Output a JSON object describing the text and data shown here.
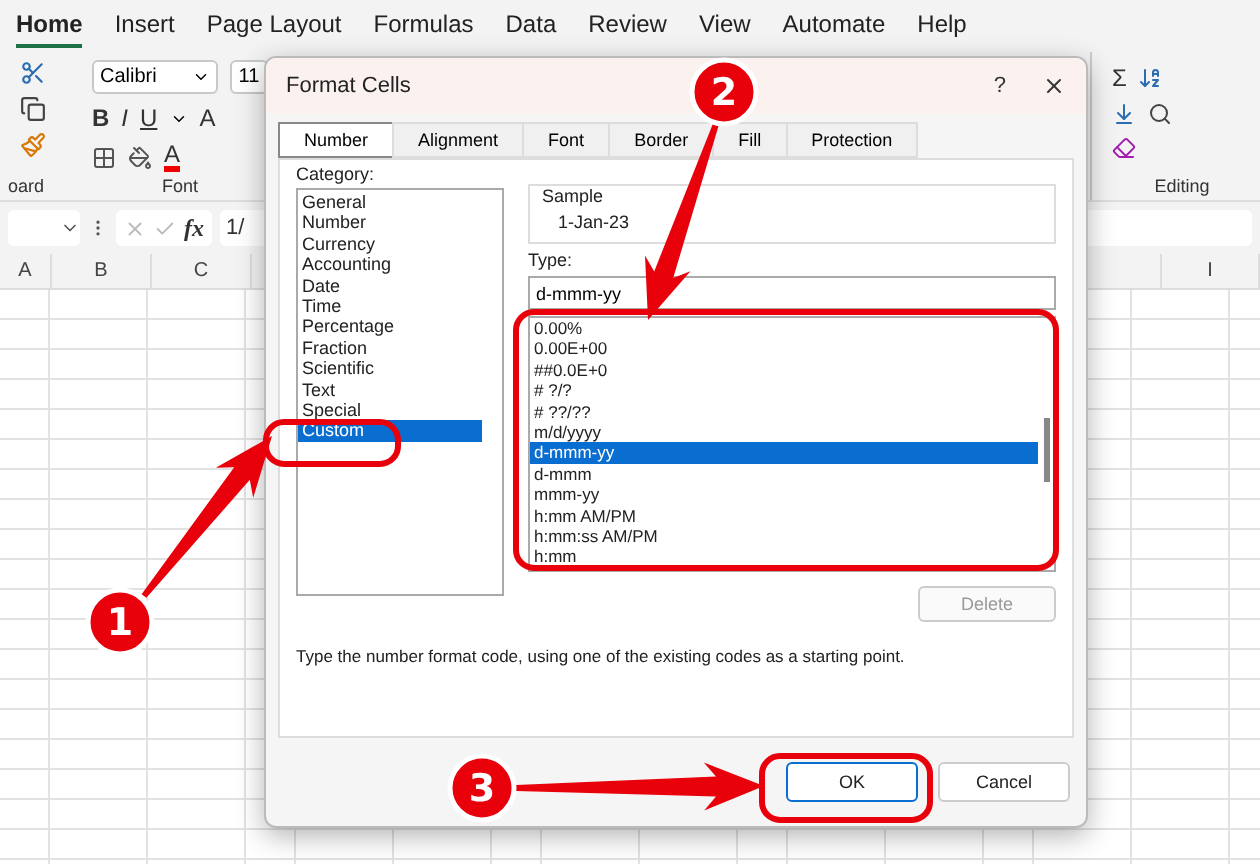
{
  "ribbon_tabs": [
    {
      "label": "Home",
      "selected": true
    },
    {
      "label": "Insert",
      "selected": false
    },
    {
      "label": "Page Layout",
      "selected": false
    },
    {
      "label": "Formulas",
      "selected": false
    },
    {
      "label": "Data",
      "selected": false
    },
    {
      "label": "Review",
      "selected": false
    },
    {
      "label": "View",
      "selected": false
    },
    {
      "label": "Automate",
      "selected": false
    },
    {
      "label": "Help",
      "selected": false
    }
  ],
  "ribbon": {
    "clipboard_label": "oard",
    "font_name": "Calibri",
    "font_size": "11",
    "bold": "B",
    "italic": "I",
    "underline": "U",
    "grow_font": "A",
    "font_color": "A",
    "font_label": "Font",
    "sum": "Σ",
    "editing_label": "Editing"
  },
  "formula_bar": {
    "fx": "fx",
    "value": "1/"
  },
  "columns": [
    "A",
    "B",
    "C"
  ],
  "right_column": "I",
  "dialog": {
    "title": "Format Cells",
    "help": "?",
    "tabs": [
      {
        "label": "Number",
        "selected": true
      },
      {
        "label": "Alignment",
        "selected": false
      },
      {
        "label": "Font",
        "selected": false
      },
      {
        "label": "Border",
        "selected": false
      },
      {
        "label": "Fill",
        "selected": false
      },
      {
        "label": "Protection",
        "selected": false
      }
    ],
    "category_label": "Category:",
    "categories": [
      {
        "label": "General",
        "selected": false
      },
      {
        "label": "Number",
        "selected": false
      },
      {
        "label": "Currency",
        "selected": false
      },
      {
        "label": "Accounting",
        "selected": false
      },
      {
        "label": "Date",
        "selected": false
      },
      {
        "label": "Time",
        "selected": false
      },
      {
        "label": "Percentage",
        "selected": false
      },
      {
        "label": "Fraction",
        "selected": false
      },
      {
        "label": "Scientific",
        "selected": false
      },
      {
        "label": "Text",
        "selected": false
      },
      {
        "label": "Special",
        "selected": false
      },
      {
        "label": "Custom",
        "selected": true
      }
    ],
    "sample_label": "Sample",
    "sample_value": "1-Jan-23",
    "type_label": "Type:",
    "type_value": "d-mmm-yy",
    "types": [
      {
        "label": "0.00%",
        "selected": false
      },
      {
        "label": "0.00E+00",
        "selected": false
      },
      {
        "label": "##0.0E+0",
        "selected": false
      },
      {
        "label": "# ?/?",
        "selected": false
      },
      {
        "label": "# ??/??",
        "selected": false
      },
      {
        "label": "m/d/yyyy",
        "selected": false
      },
      {
        "label": "d-mmm-yy",
        "selected": true
      },
      {
        "label": "d-mmm",
        "selected": false
      },
      {
        "label": "mmm-yy",
        "selected": false
      },
      {
        "label": "h:mm AM/PM",
        "selected": false
      },
      {
        "label": "h:mm:ss AM/PM",
        "selected": false
      },
      {
        "label": "h:mm",
        "selected": false
      }
    ],
    "delete_button": {
      "label": "Delete",
      "disabled": true
    },
    "hint": "Type the number format code, using one of the existing codes as a starting point.",
    "buttons": [
      {
        "label": "OK",
        "default": true
      },
      {
        "label": "Cancel",
        "default": false
      }
    ]
  },
  "annotations": [
    {
      "number": "1"
    },
    {
      "number": "2"
    },
    {
      "number": "3"
    }
  ]
}
